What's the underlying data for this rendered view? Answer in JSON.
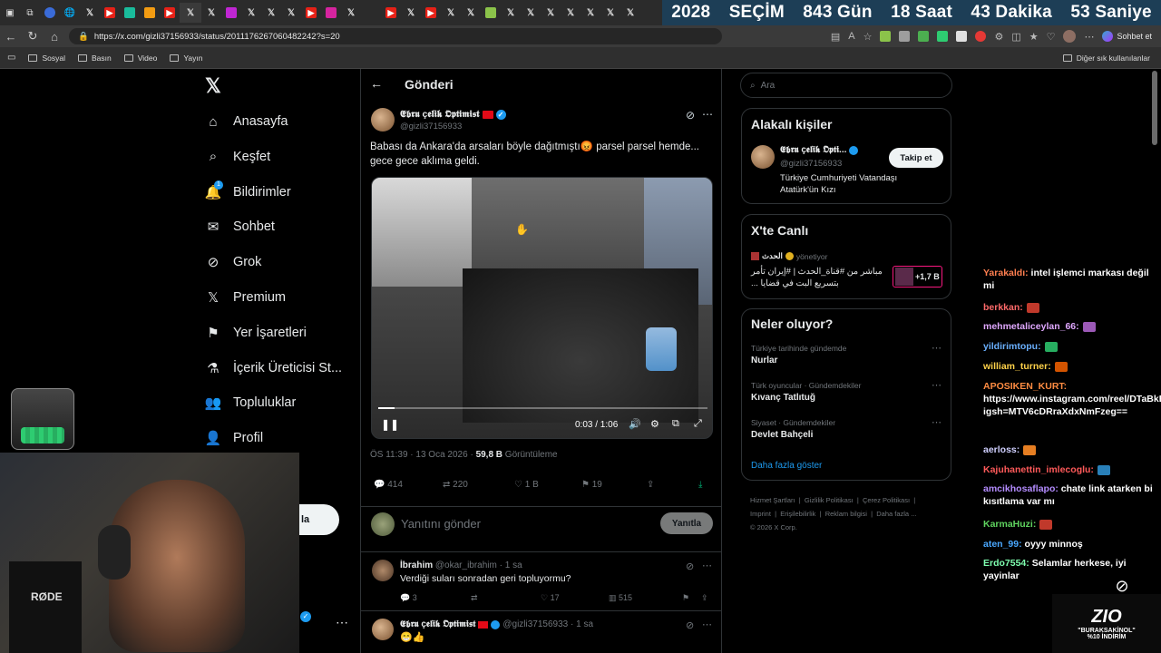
{
  "browser": {
    "url": "https://x.com/gizli37156933/status/2011176267060482242?s=20",
    "bookmarks": [
      "Sosyal",
      "Basın",
      "Video",
      "Yayın"
    ],
    "other_bookmarks": "Diğer sık kullanılanlar",
    "copilot_label": "Sohbet et",
    "banner": {
      "year": "2028",
      "election": "SEÇİM",
      "days": "843 Gün",
      "hours": "18 Saat",
      "minutes": "43 Dakika",
      "seconds": "53 Saniye"
    }
  },
  "nav": {
    "items": [
      {
        "label": "Anasayfa",
        "icon": "home-icon"
      },
      {
        "label": "Keşfet",
        "icon": "search-icon"
      },
      {
        "label": "Bildirimler",
        "icon": "bell-icon",
        "badge": "1"
      },
      {
        "label": "Sohbet",
        "icon": "mail-icon"
      },
      {
        "label": "Grok",
        "icon": "grok-icon"
      },
      {
        "label": "Premium",
        "icon": "x-logo-icon"
      },
      {
        "label": "Yer İşaretleri",
        "icon": "bookmark-icon"
      },
      {
        "label": "İçerik Üreticisi St...",
        "icon": "creator-icon"
      },
      {
        "label": "Topluluklar",
        "icon": "community-icon"
      },
      {
        "label": "Profil",
        "icon": "profile-icon"
      }
    ],
    "post_button_partial": "la"
  },
  "post": {
    "header": "Gönderi",
    "author_name": "𝕰𝖇𝖗𝖚 ç𝖊𝖑𝖎𝖐 𝕺𝖕𝖙𝖎𝖒𝖎𝖘𝖙",
    "author_handle": "@gizli37156933",
    "text": "Babası da Ankara'da arsaları böyle dağıtmıştı😡 parsel parsel hemde... gece gece aklıma geldi.",
    "video_time": "0:03 / 1:06",
    "video_progress": 0.05,
    "meta_time": "ÖS 11:39 · 13 Oca 2026 · ",
    "views": "59,8 B",
    "views_label": " Görüntüleme",
    "stats": {
      "replies": "414",
      "reposts": "220",
      "likes": "1 B",
      "bookmarks": "19"
    },
    "reply_placeholder": "Yanıtını gönder",
    "reply_button": "Yanıtla"
  },
  "replies": [
    {
      "name": "İbrahim",
      "handle": "@okar_ibrahim · 1 sa",
      "text": "Verdiği suları sonradan geri topluyormu?",
      "replies": "3",
      "likes": "17",
      "views": "515"
    },
    {
      "name": "𝕰𝖇𝖗𝖚 ç𝖊𝖑𝖎𝖐 𝕺𝖕𝖙𝖎𝖒𝖎𝖘𝖙",
      "handle": "@gizli37156933 · 1 sa",
      "text": "😁👍"
    }
  ],
  "sidebar": {
    "search_placeholder": "Ara",
    "related": {
      "title": "Alakalı kişiler",
      "name": "𝕰𝖇𝖗𝖚 ç𝖊𝖑𝖎𝖐 𝕺𝖕𝖙𝖎...",
      "handle": "@gizli37156933",
      "bio": "Türkiye Cumhuriyeti Vatandaşı Atatürk'ün Kızı",
      "follow": "Takip et"
    },
    "live": {
      "title": "X'te Canlı",
      "host": "الحدث",
      "host_role": "yönetiyor",
      "text": "مباشر من #قناة_الحدث | #إيران تأمر بتسريع البت في قضايا ...",
      "count": "+1,7 B"
    },
    "trends": {
      "title": "Neler oluyor?",
      "items": [
        {
          "sub": "Türkiye tarihinde gündemde",
          "main": "Nurlar"
        },
        {
          "sub": "Türk oyuncular · Gündemdekiler",
          "main": "Kıvanç Tatlıtuğ"
        },
        {
          "sub": "Siyaset · Gündemdekiler",
          "main": "Devlet Bahçeli"
        }
      ],
      "more": "Daha fazla göster"
    },
    "footer": [
      "Hizmet Şartları",
      "|",
      "Gizlilik Politikası",
      "|",
      "Çerez Politikası",
      "|",
      "Imprint",
      "|",
      "Erişilebilirlik",
      "|",
      "Reklam bilgisi",
      "|",
      "Daha fazla ...",
      "© 2026 X Corp."
    ]
  },
  "chat": [
    {
      "user": "Yarakaldı:",
      "color": "#ff7f50",
      "msg": " intel işlemci markası değil mi"
    },
    {
      "user": "berkkan:",
      "color": "#ff6a6a",
      "msg": ""
    },
    {
      "user": "mehmetaliceylan_66:",
      "color": "#e0a8ff",
      "msg": ""
    },
    {
      "user": "yildirimtopu:",
      "color": "#6ab0ff",
      "msg": ""
    },
    {
      "user": "william_turner:",
      "color": "#ffd24a",
      "msg": ""
    },
    {
      "user": "APOSIKEN_KURT:",
      "color": "#ff8c42",
      "msg": " https://www.instagram.com/reel/DTaBkEFAIoS/?igsh=MTV6cDRraXdxNmFzeg=="
    },
    {
      "user": "aerloss:",
      "color": "#d0d0ff",
      "msg": ""
    },
    {
      "user": "Kajuhanettin_imlecoglu:",
      "color": "#ff5a5a",
      "msg": ""
    },
    {
      "user": "amcikhosaflapo:",
      "color": "#b48cff",
      "msg": " chate link atarken bi kısıtlama var mı"
    },
    {
      "user": "KarmaHuzi:",
      "color": "#5fd35f",
      "msg": ""
    },
    {
      "user": "aten_99:",
      "color": "#4aa8ff",
      "msg": " oyyy minnoş"
    },
    {
      "user": "Erdo7554:",
      "color": "#7fffb0",
      "msg": " Selamlar herkese, iyi yayinlar"
    }
  ],
  "overlay": {
    "brand": "ZIO",
    "promo": "\"BURAKSAKİNOL\"",
    "discount": "%10 İNDİRİM",
    "mic_label": "RØDE"
  }
}
